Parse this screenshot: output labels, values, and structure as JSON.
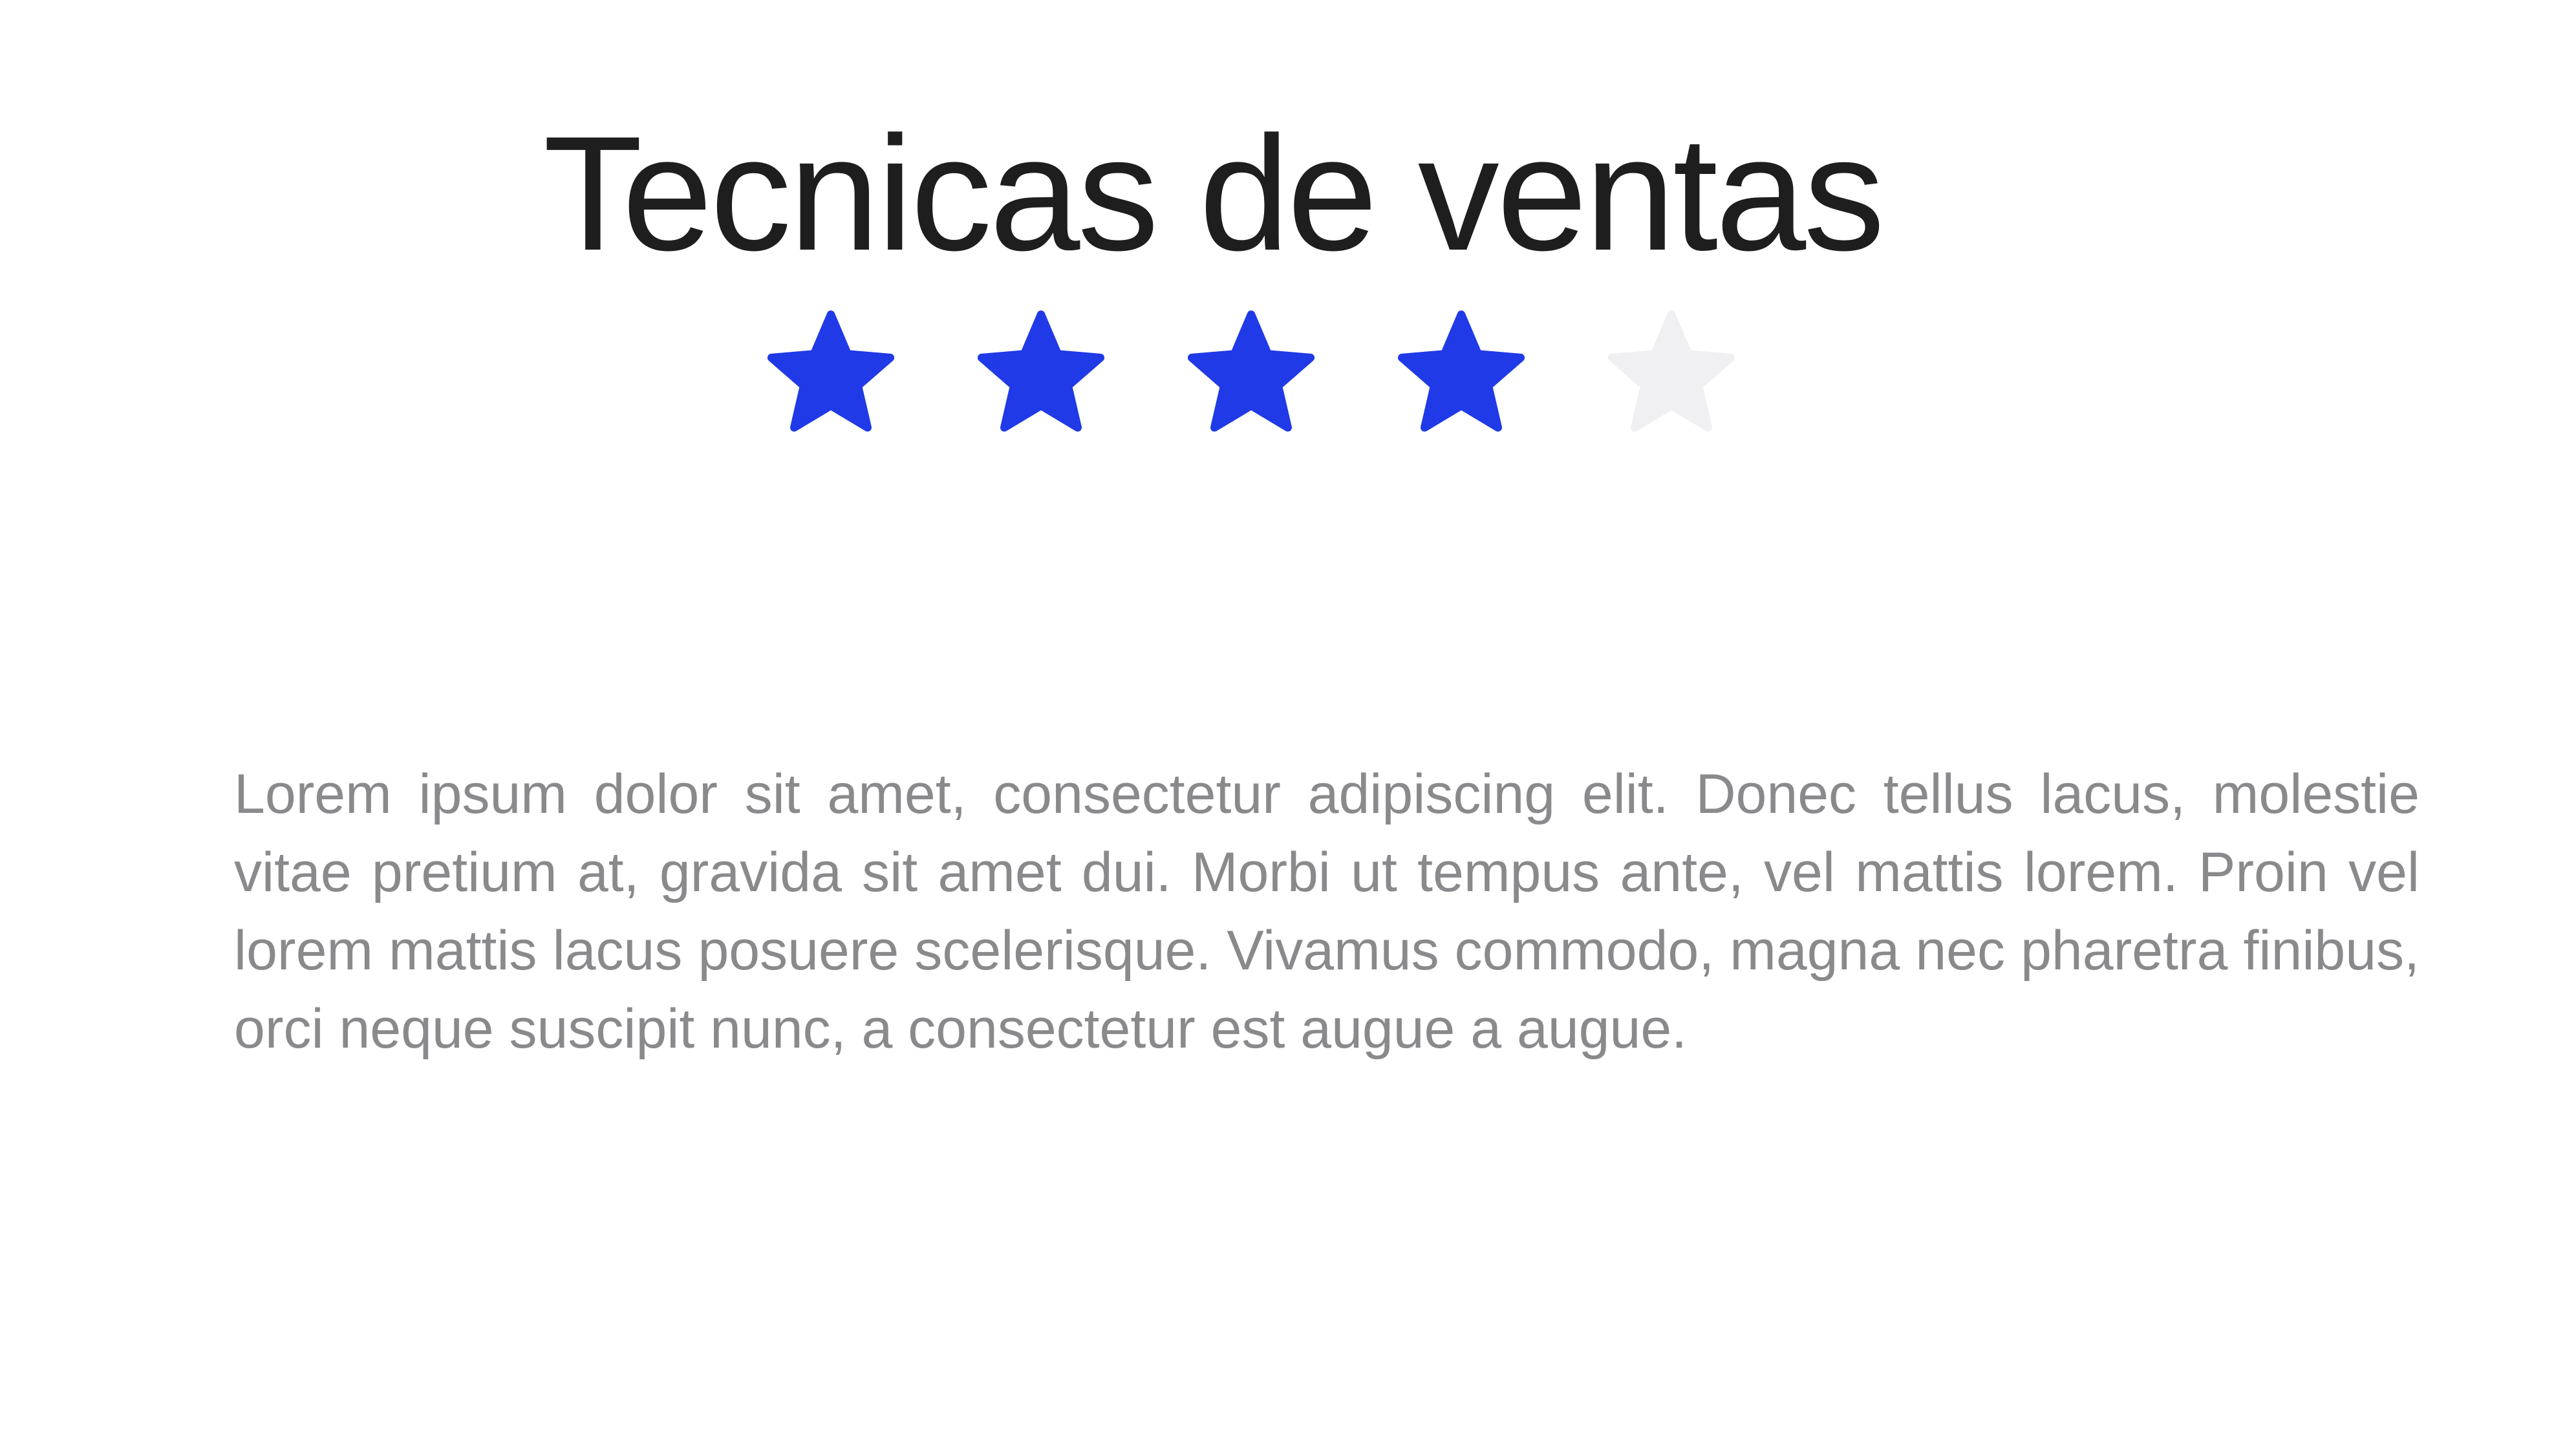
{
  "card": {
    "title": "Tecnicas de ventas",
    "rating": {
      "value": 4,
      "max": 5,
      "filled_color": "#1f3ae6",
      "empty_color": "#f0f0f2",
      "icon": "star-icon"
    },
    "description": "Lorem ipsum dolor sit amet, consectetur adipiscing elit. Donec tellus lacus, molestie vitae pretium at, gravida sit amet dui. Morbi ut tempus ante, vel mattis lorem. Proin vel lorem mattis lacus posuere scelerisque. Vivamus commodo, magna nec pharetra finibus, orci neque suscipit nunc, a consectetur est augue a augue."
  }
}
